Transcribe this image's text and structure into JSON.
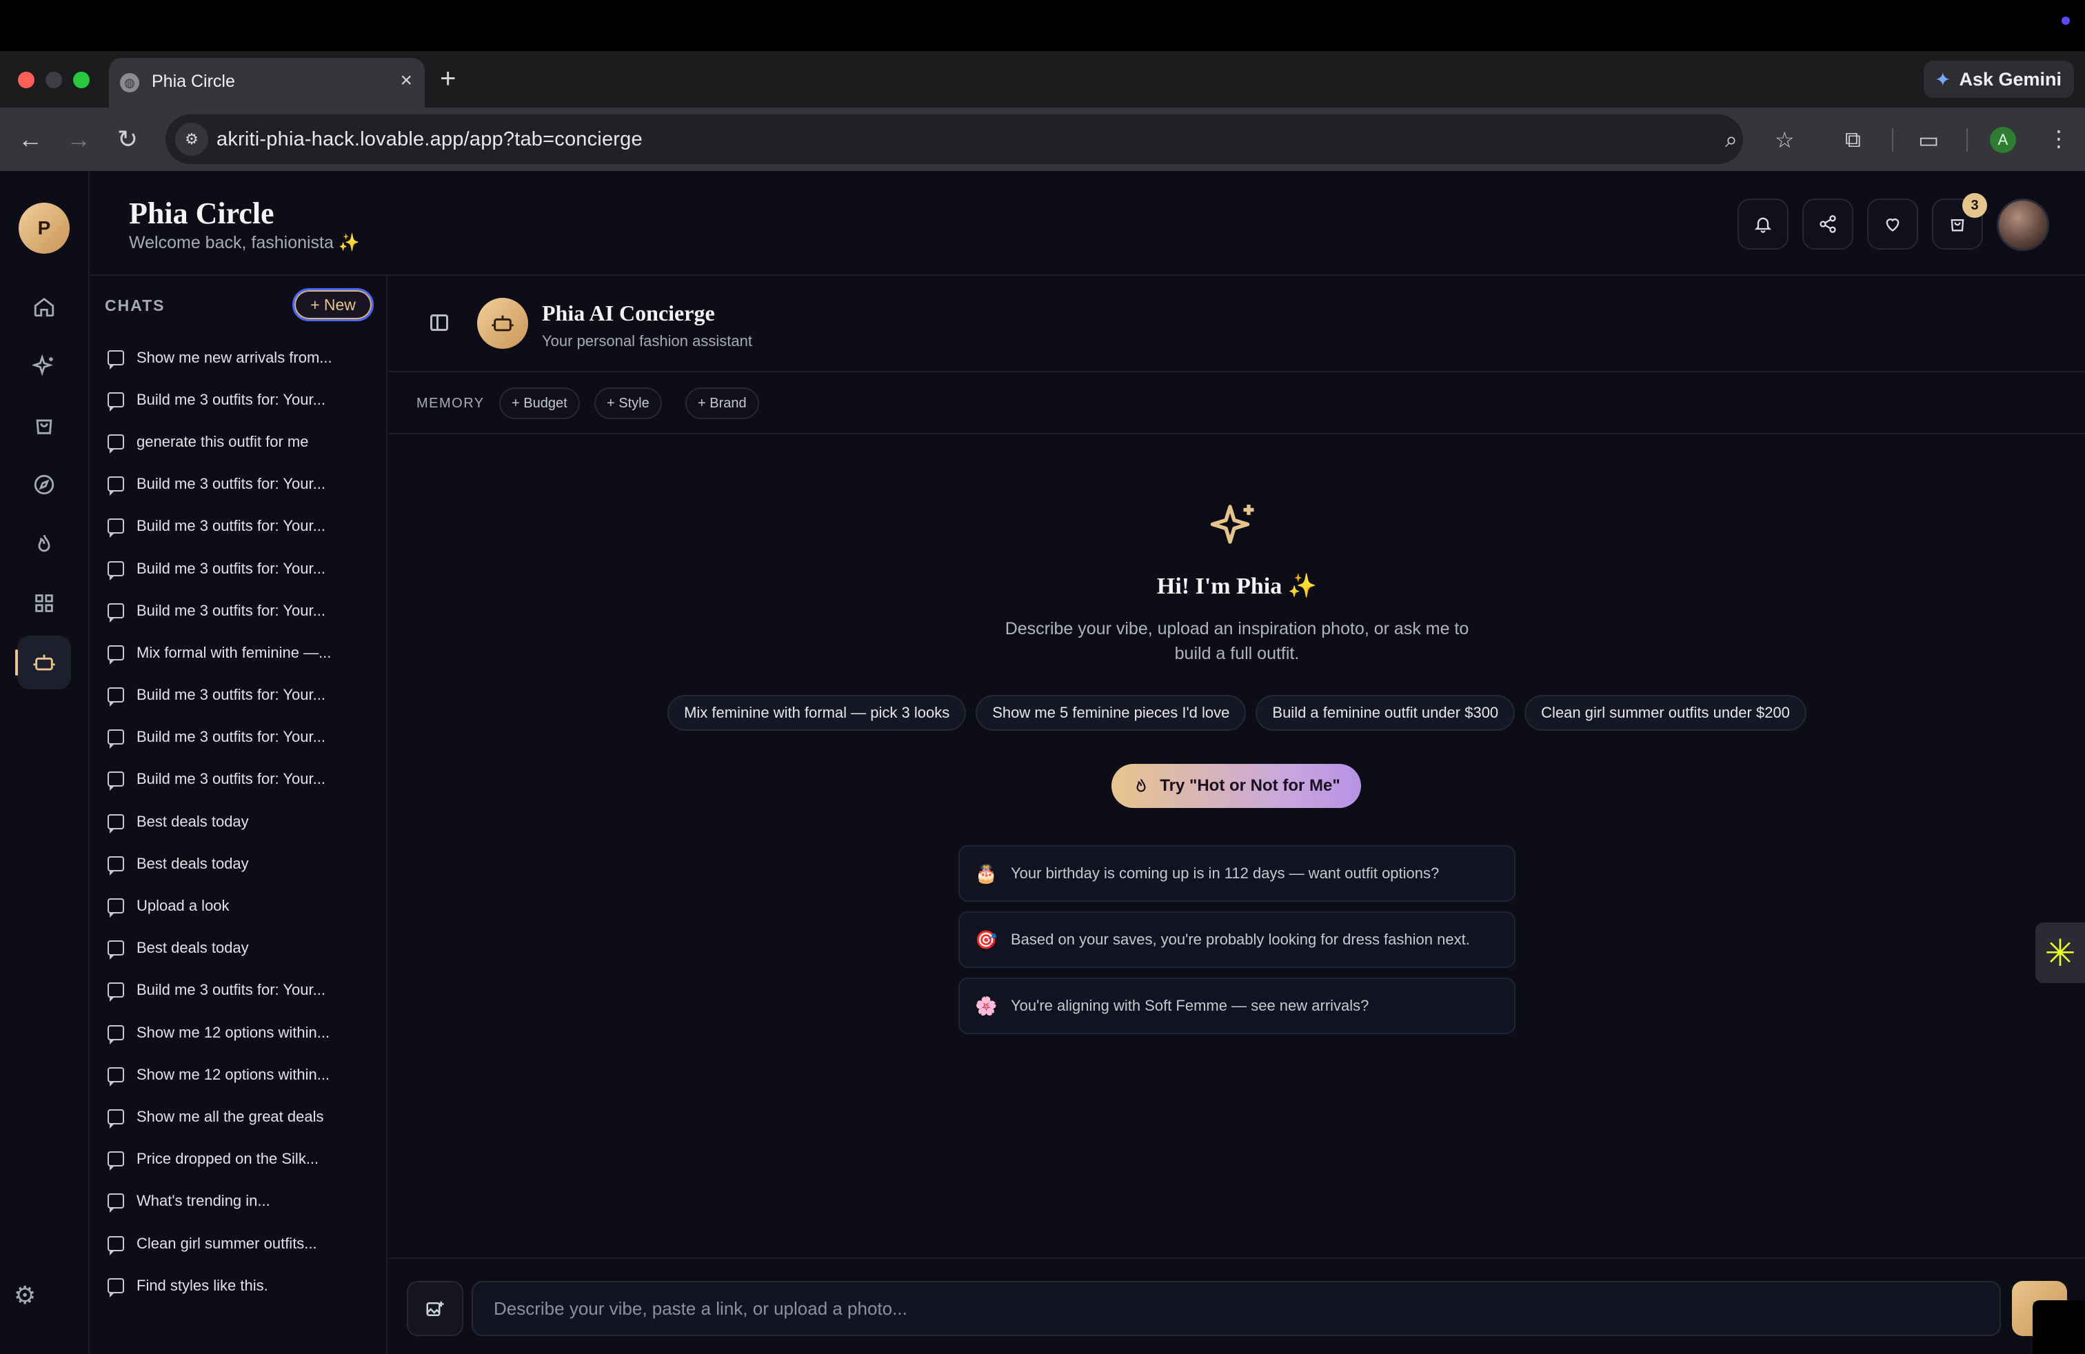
{
  "browser": {
    "tab_title": "Phia Circle",
    "new_tab": "+",
    "gemini_label": "Ask Gemini",
    "url": "akriti-phia-hack.lovable.app/app?tab=concierge",
    "profile_initial": "A"
  },
  "header": {
    "brand": "Phia Circle",
    "welcome": "Welcome back, fashionista ✨",
    "cart_count": "3"
  },
  "rail": {
    "avatar_initial": "P"
  },
  "chats": {
    "title": "CHATS",
    "new_label": "+ New",
    "items": [
      "Show me new arrivals from...",
      "Build me 3 outfits for: Your...",
      "generate this outfit for me",
      "Build me 3 outfits for: Your...",
      "Build me 3 outfits for: Your...",
      "Build me 3 outfits for: Your...",
      "Build me 3 outfits for: Your...",
      "Mix formal with feminine —...",
      "Build me 3 outfits for: Your...",
      "Build me 3 outfits for: Your...",
      "Build me 3 outfits for: Your...",
      "Best deals today",
      "Best deals today",
      "Upload a look",
      "Best deals today",
      "Build me 3 outfits for: Your...",
      "Show me 12 options within...",
      "Show me 12 options within...",
      "Show me all the great deals",
      "Price dropped on the Silk...",
      "What's trending in...",
      "Clean girl summer outfits...",
      "Find styles like this."
    ]
  },
  "concierge": {
    "title": "Phia AI Concierge",
    "subtitle": "Your personal fashion assistant",
    "memory_label": "MEMORY",
    "memory_chips": [
      "+ Budget",
      "+ Style",
      "+ Brand"
    ],
    "hero_title": "Hi! I'm Phia ✨",
    "hero_desc": "Describe your vibe, upload an inspiration photo, or ask me to build a full outfit.",
    "suggestions": [
      "Mix feminine with formal — pick 3 looks",
      "Show me 5 feminine pieces I'd love",
      "Build a feminine outfit under $300",
      "Clean girl summer outfits under $200"
    ],
    "hot_button": "Try \"Hot or Not for Me\"",
    "insights": [
      {
        "icon": "🎂",
        "text": "Your birthday is coming up is in 112 days — want outfit options?"
      },
      {
        "icon": "🎯",
        "text": "Based on your saves, you're probably looking for dress fashion next."
      },
      {
        "icon": "🌸",
        "text": "You're aligning with Soft Femme — see new arrivals?"
      }
    ],
    "input_placeholder": "Describe your vibe, paste a link, or upload a photo..."
  },
  "colors": {
    "background": "#0c0d16",
    "accent_gold": "#e6c48d",
    "accent_blue": "#4a68ff"
  }
}
